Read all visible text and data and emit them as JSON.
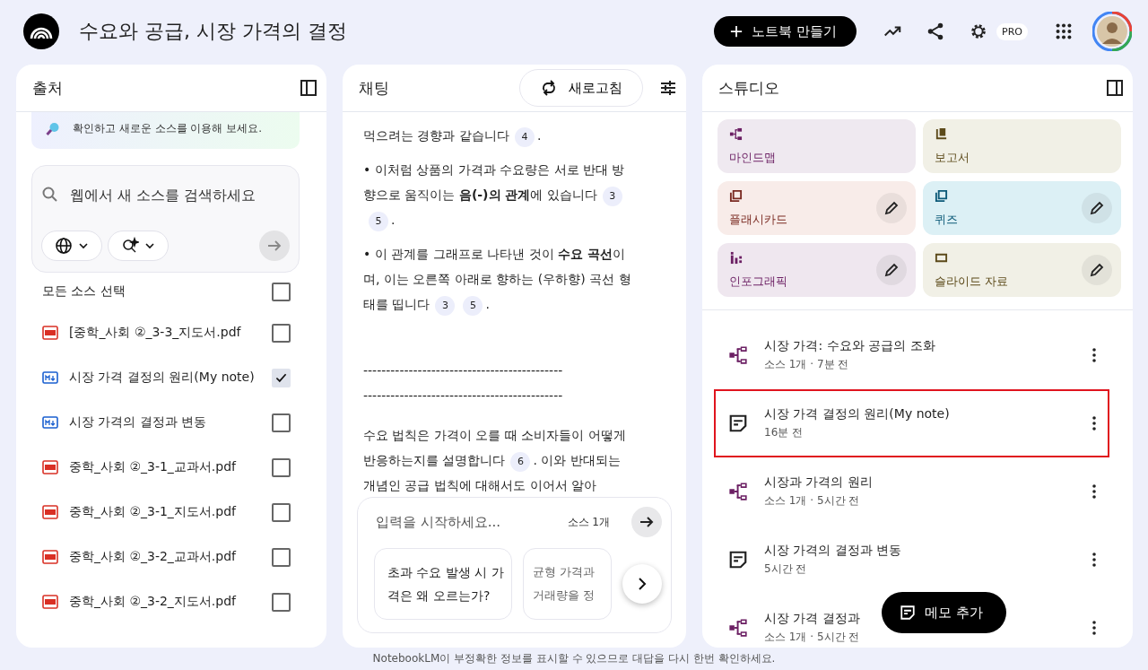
{
  "header": {
    "title": "수요와 공급, 시장 가격의 결정",
    "create_button": "노트북 만들기",
    "pro_badge": "PRO"
  },
  "sources": {
    "title": "출처",
    "banner_text": "확인하고 새로운 소스를 이용해 보세요.",
    "search": {
      "placeholder": "웹에서 새 소스를 검색하세요"
    },
    "select_all": {
      "label": "모든 소스 선택",
      "checked": false
    },
    "items": [
      {
        "name": "[중학_사회 ②_3-3_지도서.pdf",
        "kind": "pdf",
        "checked": false
      },
      {
        "name": "시장 가격 결정의 원리(My note)",
        "kind": "note",
        "checked": true
      },
      {
        "name": "시장 가격의 결정과 변동",
        "kind": "note",
        "checked": false
      },
      {
        "name": "중학_사회 ②_3-1_교과서.pdf",
        "kind": "pdf",
        "checked": false
      },
      {
        "name": "중학_사회 ②_3-1_지도서.pdf",
        "kind": "pdf",
        "checked": false
      },
      {
        "name": "중학_사회 ②_3-2_교과서.pdf",
        "kind": "pdf",
        "checked": false
      },
      {
        "name": "중학_사회 ②_3-2_지도서.pdf",
        "kind": "pdf",
        "checked": false
      }
    ]
  },
  "chat": {
    "title": "채팅",
    "refresh_button": "새로고침",
    "paragraphs": [
      [
        {
          "text": "먹으려는 경향과 같습니다"
        },
        {
          "cite": "4"
        },
        {
          "text": "."
        }
      ],
      [
        {
          "text": "• 이처럼 상품의 가격과 수요량은 서로 반대 방향으로 움직이는 **음(-)의 관계**에 있습니다"
        },
        {
          "cite": "3"
        },
        {
          "cite": "5"
        },
        {
          "text": "."
        }
      ],
      [
        {
          "text": "• 이 관계를 그래프로 나타낸 것이 **수요 곡선**이며, 이는 오른쪽 아래로 향하는 (우하향) 곡선 형태를 띱니다"
        },
        {
          "cite": "3"
        },
        {
          "cite": "5"
        },
        {
          "text": "."
        }
      ],
      [
        {
          "text": "--------------------------------------------"
        }
      ],
      [
        {
          "text": "--------------------------------------------"
        }
      ],
      [
        {
          "text": "수요 법칙은 가격이 오를 때 소비자들이 어떻게 반응하는지를 설명합니다"
        },
        {
          "cite": "6"
        },
        {
          "text": ". 이와 반대되는 개념인 공급 법칙에 대해서도 이어서 알아"
        }
      ]
    ],
    "input": {
      "placeholder": "입력을 시작하세요...",
      "source_count": "소스 1개"
    },
    "suggestions": [
      "초과 수요 발생 시 가격은 왜 오르는가?",
      "균형 가격과 거래량을 정"
    ]
  },
  "studio": {
    "title": "스튜디오",
    "tiles": [
      {
        "label": "마인드맵",
        "kind": "mindmap",
        "color": "#6b1f63",
        "editable": false
      },
      {
        "label": "보고서",
        "kind": "report",
        "color": "#5c4a1a",
        "editable": false
      },
      {
        "label": "플래시카드",
        "kind": "flashcard",
        "color": "#7a2a22",
        "editable": true
      },
      {
        "label": "퀴즈",
        "kind": "quiz",
        "color": "#0c5a78",
        "editable": true
      },
      {
        "label": "인포그래픽",
        "kind": "infographic",
        "color": "#6b1f63",
        "editable": true
      },
      {
        "label": "슬라이드 자료",
        "kind": "slides",
        "color": "#5c4a1a",
        "editable": true
      }
    ],
    "notes": [
      {
        "title": "시장 가격: 수요와 공급의 조화",
        "meta": "소스 1개 · 7분 전",
        "kind": "mindmap",
        "highlighted": false
      },
      {
        "title": "시장 가격 결정의 원리(My note)",
        "meta": "16분 전",
        "kind": "note",
        "highlighted": true
      },
      {
        "title": "시장과 가격의 원리",
        "meta": "소스 1개 · 5시간 전",
        "kind": "mindmap",
        "highlighted": false
      },
      {
        "title": "시장 가격의 결정과 변동",
        "meta": "5시간 전",
        "kind": "note",
        "highlighted": false
      },
      {
        "title": "시장 가격 결정과",
        "meta": "소스 1개 · 5시간 전",
        "kind": "mindmap",
        "highlighted": false
      }
    ],
    "add_note_button": "메모 추가"
  },
  "footer": "NotebookLM이 부정확한 정보를 표시할 수 있으므로 대답을 다시 한번 확인하세요."
}
